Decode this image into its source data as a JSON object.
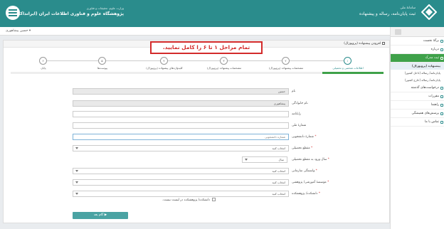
{
  "header": {
    "institute_sub": "وزارت علوم، تحقیقات و فناوری",
    "institute_main": "پژوهشگاه علوم و فناوری اطلاعات ایران (ایرانداک)",
    "system_sub": "سامانهٔ ملی",
    "system_main": "ثبت پایان‌نامه، رساله و پیشنهاده"
  },
  "userbar": {
    "name": "حسین پیشاهوری ▾"
  },
  "sidebar": {
    "items": [
      {
        "label": "برگهٔ نخست"
      },
      {
        "label": "درباره"
      },
      {
        "label": "ثبت مدرک"
      },
      {
        "label": "پیشنهاده (پروپوزال)"
      },
      {
        "label": "پایان‌نامه/ رساله (داخل کشور)"
      },
      {
        "label": "پایان‌نامه/ رساله (خارج کشور)"
      },
      {
        "label": "درخواست‌های گذشته"
      },
      {
        "label": "مقررات"
      },
      {
        "label": "راهنما"
      },
      {
        "label": "پرسش‌های همیشگی"
      },
      {
        "label": "تماس با ما"
      }
    ]
  },
  "panel": {
    "title": "افزودن پیشنهاده (پروپوزال)",
    "banner": "تمام مراحل ۱ تا ۶ را کامل نمایید."
  },
  "steps": [
    {
      "num": "۱",
      "label": "اطلاعات شخصی و تحصیلی"
    },
    {
      "num": "۲",
      "label": "مشخصات پیشنهاده (پروپوزال)"
    },
    {
      "num": "۳",
      "label": "مشخصات پیشنهاده (پروپوزال)"
    },
    {
      "num": "۴",
      "label": "کلیدواژه‌های پیشنهاده (پروپوزال)"
    },
    {
      "num": "۵",
      "label": "پیوست‌ها"
    },
    {
      "num": "۶",
      "label": "پایان"
    }
  ],
  "form": {
    "first_name_label": "نام",
    "first_name_value": "حسین",
    "last_name_label": "نام خانوادگی",
    "last_name_value": "پیشاهوری",
    "email_label": "رایانامه",
    "national_code_label": "شمارهٔ ملی",
    "student_no_label": "شمارهٔ دانشجویی",
    "student_no_placeholder": "شماره دانشجویی",
    "degree_label": "مقطع تحصیلی",
    "degree_value": "انتخاب کنید",
    "entry_year_label": "سال ورود به مقطع تحصیلی",
    "entry_year_value": "سال",
    "org_label": "وابستگی سازمانی",
    "org_value": "انتخاب کنید",
    "edu_label": "مؤسسهٔ آموزشی/ پژوهشی",
    "edu_value": "انتخاب کنید",
    "faculty_label": "دانشکده/ پژوهشکده",
    "faculty_value": "انتخاب کنید",
    "checkbox_label": "دانشکده/ پژوهشکده در لیست نیست.",
    "next_button": "گام بعد ▶"
  }
}
